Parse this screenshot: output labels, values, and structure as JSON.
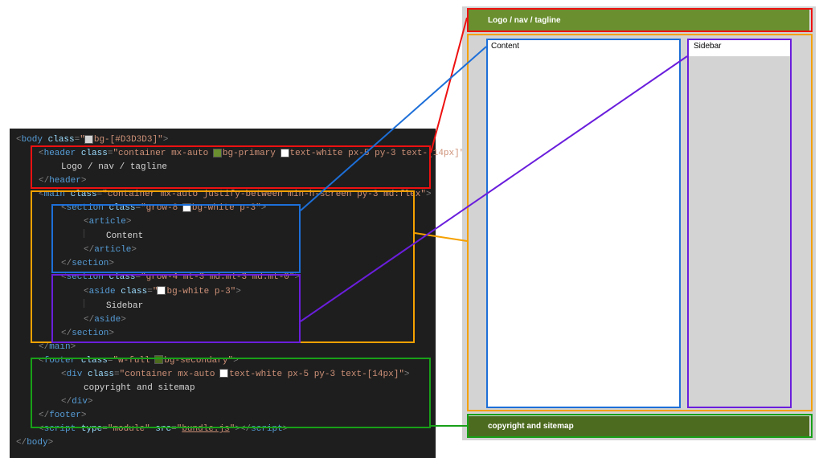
{
  "code": {
    "body_class": "bg-[#D3D3D3]",
    "header_class": "container mx-auto bg-primary text-white px-5 py-3 text-[14px]",
    "header_text": "Logo / nav / tagline",
    "main_class": "container mx-auto justify-between min-h-screen py-3 md:flex",
    "section1_class": "grow-8 bg-white p-3",
    "article_text": "Content",
    "section2_class": "grow-4 mt-3 md:ml-3 md:mt-0",
    "aside_class": "bg-white p-3",
    "aside_text": "Sidebar",
    "footer_class": "w-full bg-secondary",
    "footer_div_class": "container mx-auto text-white px-5 py-3 text-[14px]",
    "footer_text": "copyright and sitemap",
    "script_type": "module",
    "script_src": "bundle.js"
  },
  "preview": {
    "header": "Logo / nav / tagline",
    "content": "Content",
    "sidebar": "Sidebar",
    "footer": "copyright and sitemap"
  },
  "swatches": {
    "light": "#d3d3d3",
    "primary": "#6a8f2f",
    "secondary": "#4d6b1f",
    "white": "#ffffff"
  }
}
